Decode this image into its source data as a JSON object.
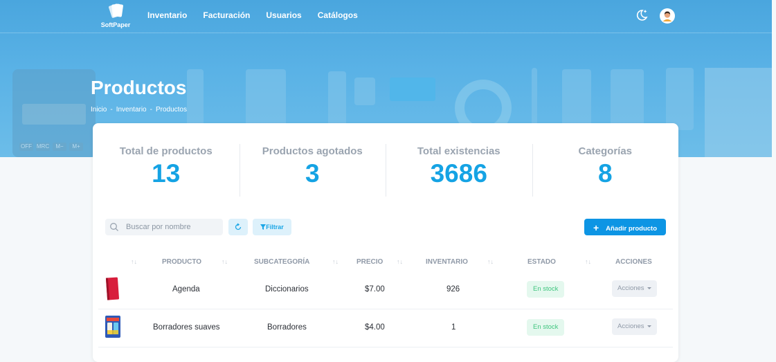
{
  "brand": {
    "name": "SoftPaper"
  },
  "nav": {
    "items": [
      {
        "label": "Inventario"
      },
      {
        "label": "Facturación"
      },
      {
        "label": "Usuarios"
      },
      {
        "label": "Catálogos"
      }
    ],
    "theme_icon": "moon-star-icon",
    "avatar_icon": "user-avatar"
  },
  "banner": {
    "calc_keys": [
      "OFF",
      "MRC",
      "M−",
      "M+"
    ]
  },
  "page": {
    "title": "Productos",
    "breadcrumb": [
      "Inicio",
      "Inventario",
      "Productos"
    ],
    "breadcrumb_sep": "-"
  },
  "stats": [
    {
      "label": "Total de productos",
      "value": "13"
    },
    {
      "label": "Productos agotados",
      "value": "3"
    },
    {
      "label": "Total existencias",
      "value": "3686"
    },
    {
      "label": "Categorías",
      "value": "8"
    }
  ],
  "toolbar": {
    "search_placeholder": "Buscar por nombre",
    "refresh_icon": "refresh-icon",
    "filter_label": "Filtrar",
    "add_label": "Añadir producto"
  },
  "table": {
    "columns": [
      "PRODUCTO",
      "SUBCATEGORÍA",
      "PRECIO",
      "INVENTARIO",
      "ESTADO",
      "ACCIONES"
    ],
    "sort_glyph": "↑↓",
    "rows": [
      {
        "product": "Agenda",
        "subcategory": "Diccionarios",
        "price": "$7.00",
        "inventory": "926",
        "status": "En stock",
        "actions": "Acciones",
        "thumb_icon": "red-notebook-image"
      },
      {
        "product": "Borradores suaves",
        "subcategory": "Borradores",
        "price": "$4.00",
        "inventory": "1",
        "status": "En stock",
        "actions": "Acciones",
        "thumb_icon": "eraser-pack-image"
      }
    ]
  },
  "colors": {
    "accent": "#15a3e4",
    "primary_button": "#0d95e4",
    "banner": "#4aa6de",
    "stock_badge_bg": "#e4f8ee",
    "stock_badge_text": "#3fc57e"
  }
}
